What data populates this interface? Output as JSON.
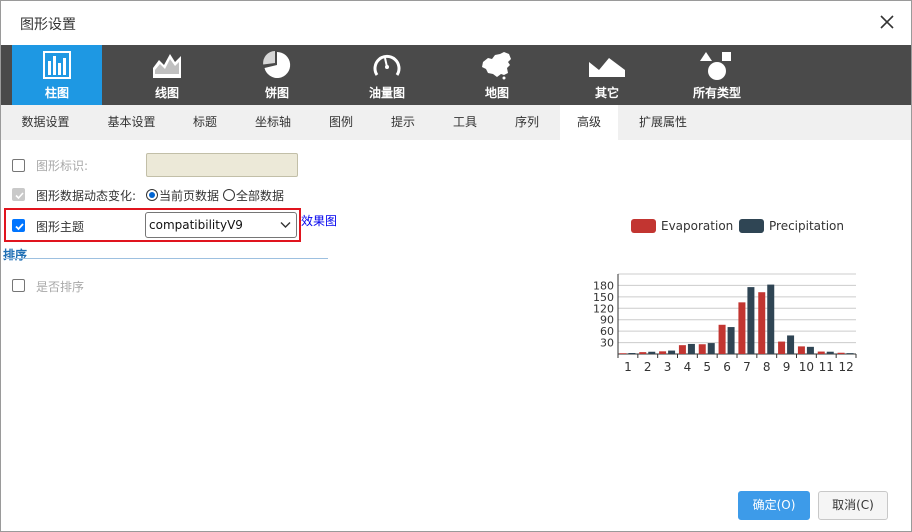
{
  "dialog": {
    "title": "图形设置"
  },
  "chart_types": [
    {
      "label": "柱图",
      "icon": "bar-chart-icon",
      "active": true
    },
    {
      "label": "线图",
      "icon": "line-chart-icon",
      "active": false
    },
    {
      "label": "饼图",
      "icon": "pie-chart-icon",
      "active": false
    },
    {
      "label": "油量图",
      "icon": "gauge-icon",
      "active": false
    },
    {
      "label": "地图",
      "icon": "china-map-icon",
      "active": false
    },
    {
      "label": "其它",
      "icon": "mountain-icon",
      "active": false
    },
    {
      "label": "所有类型",
      "icon": "shapes-icon",
      "active": false
    }
  ],
  "tabs": [
    {
      "label": "数据设置"
    },
    {
      "label": "基本设置"
    },
    {
      "label": "标题"
    },
    {
      "label": "坐标轴"
    },
    {
      "label": "图例"
    },
    {
      "label": "提示"
    },
    {
      "label": "工具"
    },
    {
      "label": "序列"
    },
    {
      "label": "高级",
      "active": true
    },
    {
      "label": "扩展属性"
    }
  ],
  "form": {
    "chart_id_label": "图形标识:",
    "chart_id_value": "",
    "dynamic_label": "图形数据动态变化:",
    "dynamic_option_current": "当前页数据",
    "dynamic_option_all": "全部数据",
    "theme_label": "图形主题",
    "theme_value": "compatibilityV9",
    "preview_link": "效果图",
    "sort_section": "排序",
    "sort_label": "是否排序"
  },
  "colors": {
    "evaporation": "#c23531",
    "precipitation": "#2f4554",
    "accent": "#1e98e3"
  },
  "chart_data": {
    "type": "bar",
    "categories": [
      "1",
      "2",
      "3",
      "4",
      "5",
      "6",
      "7",
      "8",
      "9",
      "10",
      "11",
      "12"
    ],
    "series": [
      {
        "name": "Evaporation",
        "values": [
          2.0,
          4.9,
          7.0,
          23.2,
          25.6,
          76.7,
          135.6,
          162.2,
          32.6,
          20.0,
          6.4,
          3.3
        ]
      },
      {
        "name": "Precipitation",
        "values": [
          2.6,
          5.9,
          9.0,
          26.4,
          28.7,
          70.7,
          175.6,
          182.2,
          48.7,
          18.8,
          6.0,
          2.3
        ]
      }
    ],
    "yticks": [
      30,
      60,
      90,
      120,
      150,
      180
    ],
    "ylim": [
      0,
      210
    ],
    "grid": true,
    "legend": "top"
  },
  "buttons": {
    "ok": "确定(O)",
    "cancel": "取消(C)"
  }
}
